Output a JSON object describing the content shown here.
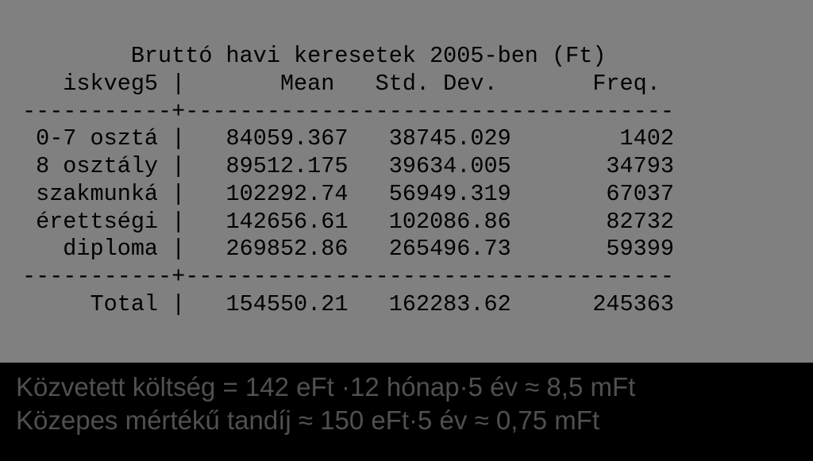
{
  "chart_data": {
    "type": "table",
    "title": "Bruttó havi keresetek 2005-ben (Ft)",
    "columns": [
      "iskveg5",
      "Mean",
      "Std. Dev.",
      "Freq."
    ],
    "rows": [
      {
        "iskveg5": "0-7 osztá",
        "mean": 84059.367,
        "std_dev": 38745.029,
        "freq": 1402
      },
      {
        "iskveg5": "8 osztály",
        "mean": 89512.175,
        "std_dev": 39634.005,
        "freq": 34793
      },
      {
        "iskveg5": "szakmunká",
        "mean": 102292.74,
        "std_dev": 56949.319,
        "freq": 67037
      },
      {
        "iskveg5": "érettségi",
        "mean": 142656.61,
        "std_dev": 102086.86,
        "freq": 82732
      },
      {
        "iskveg5": "diploma",
        "mean": 269852.86,
        "std_dev": 265496.73,
        "freq": 59399
      }
    ],
    "total": {
      "label": "Total",
      "mean": 154550.21,
      "std_dev": 162283.62,
      "freq": 245363
    }
  },
  "table_text": {
    "title_line": "        Bruttó havi keresetek 2005-ben (Ft)",
    "header_line": "   iskveg5 |       Mean   Std. Dev.       Freq.",
    "divider": "-----------+------------------------------------",
    "row0": " 0-7 osztá |   84059.367   38745.029        1402",
    "row1": " 8 osztály |   89512.175   39634.005       34793",
    "row2": " szakmunká |   102292.74   56949.319       67037",
    "row3": " érettségi |   142656.61   102086.86       82732",
    "row4": "   diploma |   269852.86   265496.73       59399",
    "total_line": "     Total |   154550.21   162283.62      245363"
  },
  "caption": {
    "line1": "Közvetett költség = 142 eFt ·12 hónap·5 év ≈ 8,5 mFt",
    "line2": "Közepes mértékű tandíj ≈ 150 eFt·5 év ≈ 0,75 mFt"
  }
}
